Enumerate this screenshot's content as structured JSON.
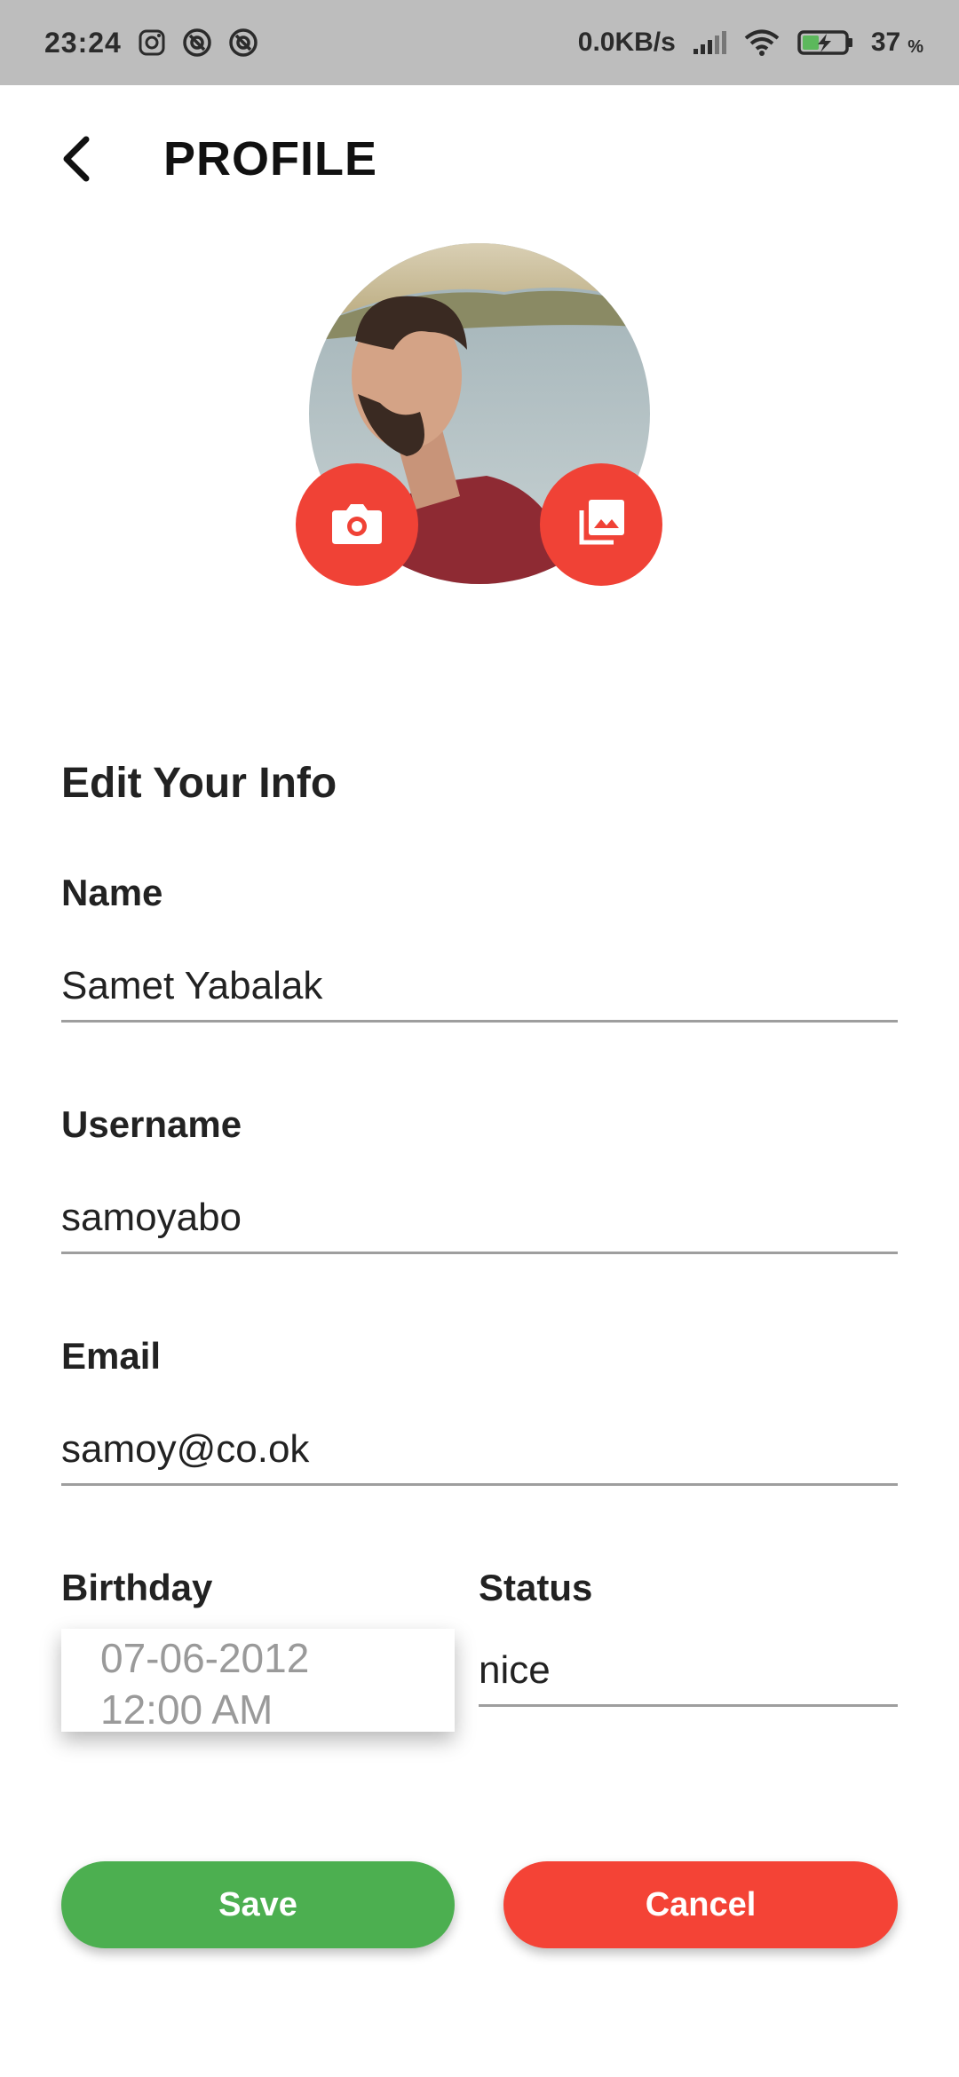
{
  "status_bar": {
    "time": "23:24",
    "network_speed": "0.0KB/s",
    "battery_percent": "37",
    "battery_unit": "%",
    "icons": [
      "instagram-icon",
      "notification-icon",
      "notification-icon",
      "signal-icon",
      "wifi-icon",
      "battery-charging-icon"
    ]
  },
  "header": {
    "title": "PROFILE",
    "back_icon": "chevron-left-icon"
  },
  "avatar": {
    "camera_icon": "camera-icon",
    "gallery_icon": "gallery-icon",
    "accent_color": "#f04236"
  },
  "form": {
    "section_title": "Edit Your Info",
    "name": {
      "label": "Name",
      "value": "Samet Yabalak"
    },
    "username": {
      "label": "Username",
      "value": "samoyabo"
    },
    "email": {
      "label": "Email",
      "value": "samoy@co.ok"
    },
    "birthday": {
      "label": "Birthday",
      "date": "07-06-2012",
      "time": "12:00 AM"
    },
    "status": {
      "label": "Status",
      "value": "nice"
    }
  },
  "actions": {
    "save_label": "Save",
    "save_color": "#4caf50",
    "cancel_label": "Cancel",
    "cancel_color": "#f44336"
  }
}
